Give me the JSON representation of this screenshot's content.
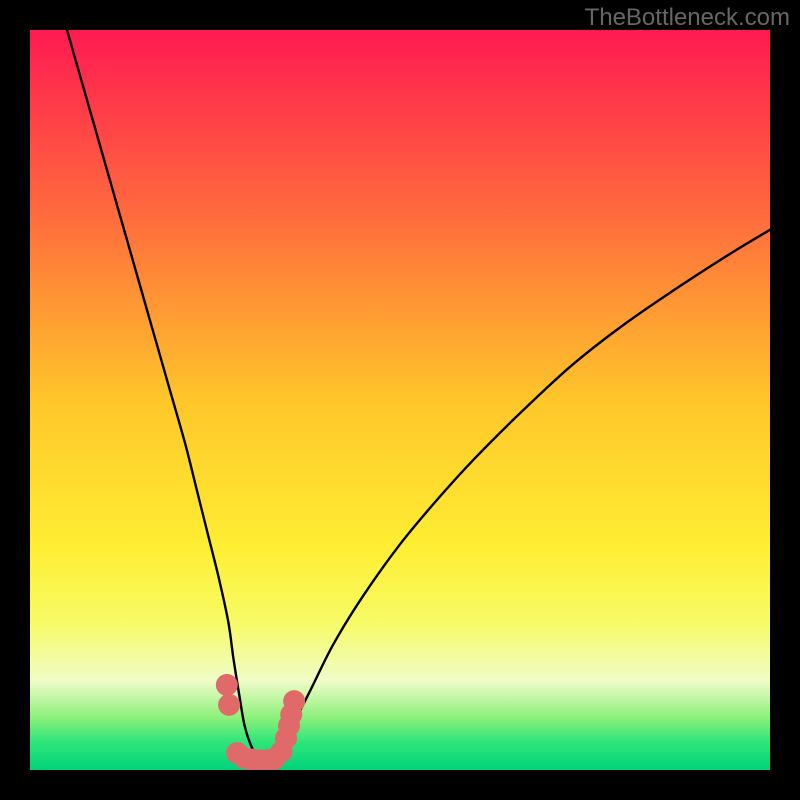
{
  "watermark": "TheBottleneck.com",
  "chart_data": {
    "type": "line",
    "title": "",
    "xlabel": "",
    "ylabel": "",
    "xlim": [
      0,
      100
    ],
    "ylim": [
      0,
      100
    ],
    "background_gradient_stops": [
      {
        "offset": 0.0,
        "color": "#ff1a52"
      },
      {
        "offset": 0.25,
        "color": "#ff6b3d"
      },
      {
        "offset": 0.5,
        "color": "#ffc62a"
      },
      {
        "offset": 0.7,
        "color": "#ffee33"
      },
      {
        "offset": 0.8,
        "color": "#f7fb66"
      },
      {
        "offset": 0.88,
        "color": "#effcc8"
      },
      {
        "offset": 0.93,
        "color": "#8af07a"
      },
      {
        "offset": 0.96,
        "color": "#33e67a"
      },
      {
        "offset": 1.0,
        "color": "#00d37a"
      }
    ],
    "series": [
      {
        "name": "bottleneck-curve",
        "x": [
          5,
          7,
          9,
          11,
          13,
          15,
          17,
          19,
          21,
          22.5,
          24,
          25.5,
          26.8,
          27.5,
          28.3,
          29,
          30,
          31,
          32,
          33,
          34,
          35.5,
          38,
          41,
          45,
          50,
          55,
          60,
          66,
          73,
          80,
          88,
          95,
          100
        ],
        "y": [
          100,
          93,
          86,
          79,
          72,
          65,
          58,
          51,
          44,
          38,
          32,
          26,
          20,
          15,
          10,
          6,
          3,
          1.5,
          1.2,
          1.5,
          3,
          6,
          11,
          17,
          23.5,
          30.5,
          36.5,
          42,
          48,
          54.5,
          60,
          65.5,
          70,
          73
        ]
      }
    ],
    "markers": {
      "name": "highlight-points",
      "color": "#e06a6a",
      "radius_px": 11,
      "x": [
        26.6,
        26.9,
        28.0,
        29.0,
        30.0,
        31.0,
        32.0,
        33.0,
        34.0,
        34.6,
        35.0,
        35.3,
        35.7
      ],
      "y": [
        11.5,
        8.8,
        2.3,
        1.6,
        1.4,
        1.3,
        1.3,
        1.5,
        2.5,
        4.3,
        6.0,
        7.5,
        9.3
      ]
    }
  }
}
